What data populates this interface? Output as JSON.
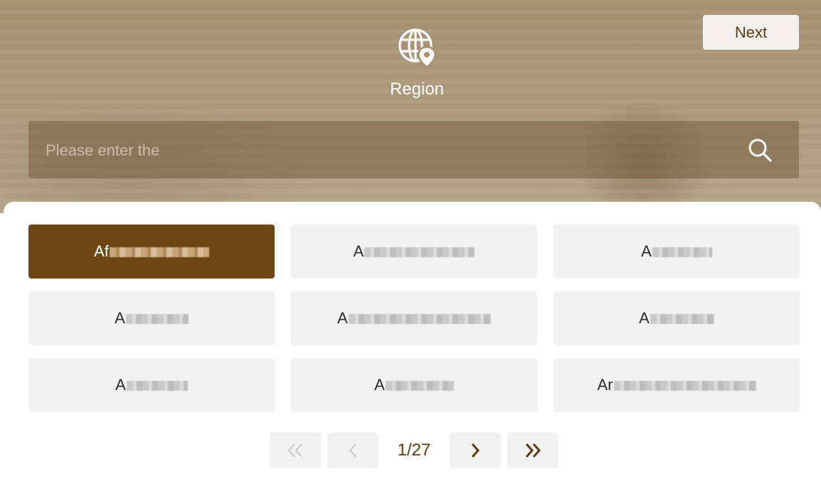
{
  "header": {
    "title": "Region",
    "icon": "globe-location-icon",
    "next_label": "Next"
  },
  "search": {
    "placeholder": "Please enter the",
    "value": "",
    "icon": "search-icon"
  },
  "regions": [
    {
      "label": "Af",
      "selected": true
    },
    {
      "label": "A",
      "selected": false
    },
    {
      "label": "A",
      "selected": false
    },
    {
      "label": "A",
      "selected": false
    },
    {
      "label": "A",
      "selected": false
    },
    {
      "label": "A",
      "selected": false
    },
    {
      "label": "A",
      "selected": false
    },
    {
      "label": "A",
      "selected": false
    },
    {
      "label": "Ar",
      "selected": false
    }
  ],
  "pagination": {
    "current": 1,
    "total": 27,
    "label": "1/27"
  },
  "colors": {
    "accent": "#6a4714",
    "accent_text": "#5e3a0f",
    "cell_bg": "#f2f2f2",
    "disabled_icon": "#c8c8c8"
  }
}
